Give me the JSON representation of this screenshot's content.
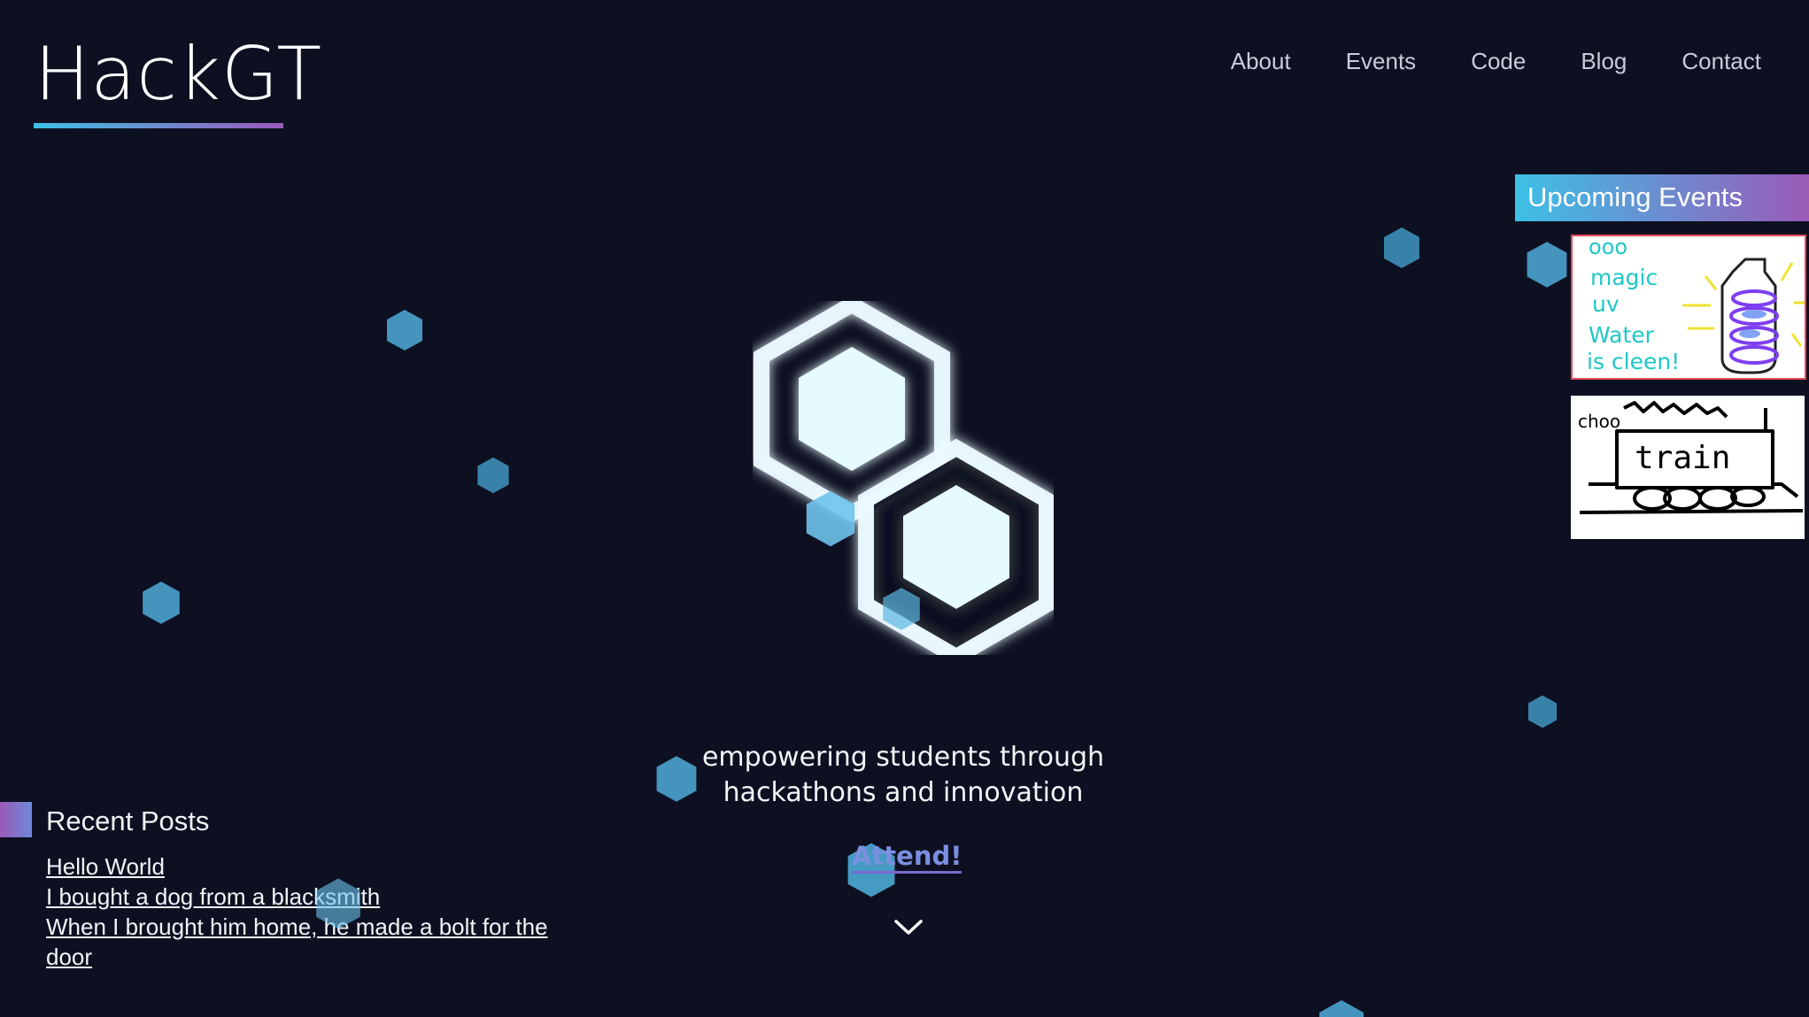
{
  "header": {
    "logo": "HackGT",
    "nav": [
      "About",
      "Events",
      "Code",
      "Blog",
      "Contact"
    ]
  },
  "hero": {
    "tagline_line1": "empowering students through",
    "tagline_line2": "hackathons and innovation",
    "cta": "Attend!",
    "scroll_icon": "chevron-down-icon"
  },
  "upcoming": {
    "title": "Upcoming Events",
    "events": [
      {
        "image_text": [
          "ooo",
          "magic",
          "uv",
          "Water",
          "is cleen!"
        ]
      },
      {
        "image_text": [
          "choo",
          "train"
        ]
      }
    ]
  },
  "recent_posts": {
    "title": "Recent Posts",
    "items": [
      "Hello World",
      "I bought a dog from a blacksmith",
      "When I brought him home, he made a bolt for the door"
    ]
  },
  "colors": {
    "background": "#0d1021",
    "accent_start": "#3cc0e6",
    "accent_end": "#9a5ab8",
    "hex_particle": "#4aa3cf"
  }
}
